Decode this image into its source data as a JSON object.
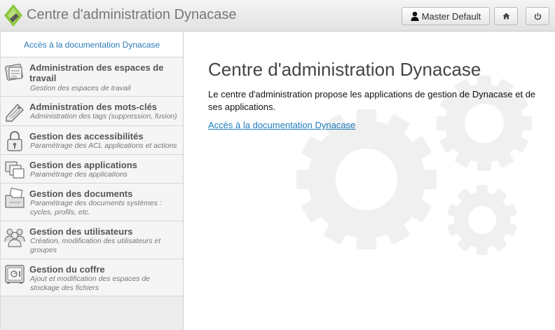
{
  "header": {
    "title": "Centre d'administration Dynacase",
    "user_label": "Master Default",
    "logo_icon": "dynacase-logo-icon",
    "home_icon": "home-icon",
    "power_icon": "power-icon"
  },
  "sidebar": {
    "doc_link": "Accès à la documentation Dynacase",
    "items": [
      {
        "title": "Administration des espaces de travail",
        "desc": "Gestion des espaces de travail",
        "icon": "workspace-icon"
      },
      {
        "title": "Administration des mots-clés",
        "desc": "Administration des tags (suppression, fusion)",
        "icon": "tag-icon"
      },
      {
        "title": "Gestion des accessibilités",
        "desc": "Paramétrage des ACL applications et actions",
        "icon": "lock-icon"
      },
      {
        "title": "Gestion des applications",
        "desc": "Paramétrage des applications",
        "icon": "applications-icon"
      },
      {
        "title": "Gestion des documents",
        "desc": "Paramétrage des documents systèmes : cycles, profils, etc.",
        "icon": "documents-icon"
      },
      {
        "title": "Gestion des utilisateurs",
        "desc": "Création, modification des utilisateurs et groupes",
        "icon": "users-icon"
      },
      {
        "title": "Gestion du coffre",
        "desc": "Ajout et modification des espaces de stockage des fichiers",
        "icon": "safe-icon"
      }
    ]
  },
  "main": {
    "title": "Centre d'administration Dynacase",
    "text": "Le centre d'administration propose les applications de gestion de Dynacase et de ses applications.",
    "doc_link": "Accès à la documentation Dynacase"
  },
  "colors": {
    "link": "#1e7cbf",
    "logo_green": "#8cc63f"
  }
}
